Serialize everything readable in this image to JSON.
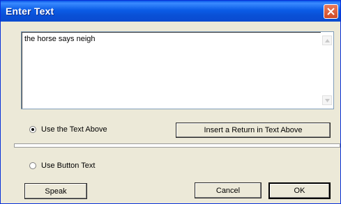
{
  "window": {
    "title": "Enter Text"
  },
  "text_area": {
    "value": "the horse says neigh"
  },
  "options": {
    "use_text_above": "Use the Text Above",
    "use_button_text": "Use Button Text",
    "selected": "use_text_above"
  },
  "buttons": {
    "insert_return": "Insert a Return in Text Above",
    "speak": "Speak",
    "cancel": "Cancel",
    "ok": "OK"
  }
}
